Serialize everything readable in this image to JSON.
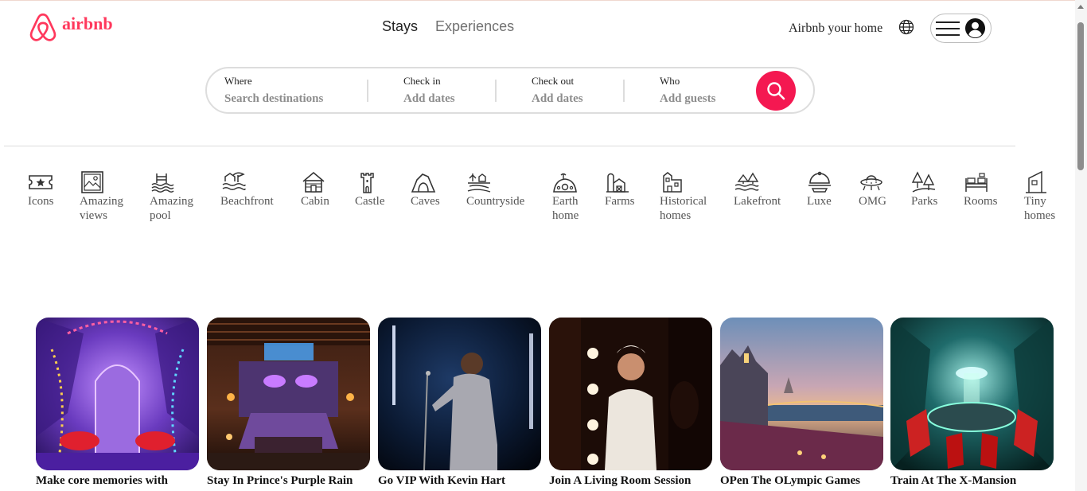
{
  "header": {
    "logo_text": "airbnb",
    "brand_color": "#ff385c",
    "tabs": [
      {
        "label": "Stays",
        "active": true
      },
      {
        "label": "Experiences",
        "active": false
      }
    ],
    "host_link": "Airbnb your home",
    "globe_icon": "globe-icon",
    "menu_icon": "hamburger-menu-icon",
    "avatar_icon": "user-avatar-icon"
  },
  "search": {
    "where": {
      "label": "Where",
      "placeholder": "Search destinations"
    },
    "check_in": {
      "label": "Check in",
      "placeholder": "Add dates"
    },
    "check_out": {
      "label": "Check out",
      "placeholder": "Add dates"
    },
    "who": {
      "label": "Who",
      "placeholder": "Add guests"
    },
    "button_color": "#f41851",
    "button_icon": "search-icon"
  },
  "categories": [
    {
      "label": "Icons",
      "icon": "ticket-star-icon"
    },
    {
      "label": "Amazing\nviews",
      "icon": "framed-picture-icon"
    },
    {
      "label": "Amazing\npool",
      "icon": "pool-icon"
    },
    {
      "label": "Beachfront",
      "icon": "beach-umbrella-icon"
    },
    {
      "label": "Cabin",
      "icon": "cabin-icon"
    },
    {
      "label": "Castle",
      "icon": "castle-icon"
    },
    {
      "label": "Caves",
      "icon": "cave-icon"
    },
    {
      "label": "Countryside",
      "icon": "countryside-icon"
    },
    {
      "label": "Earth\nhome",
      "icon": "earth-home-icon"
    },
    {
      "label": "Farms",
      "icon": "farm-icon"
    },
    {
      "label": "Historical\nhomes",
      "icon": "historical-home-icon"
    },
    {
      "label": "Lakefront",
      "icon": "lakefront-icon"
    },
    {
      "label": "Luxe",
      "icon": "cloche-icon"
    },
    {
      "label": "OMG",
      "icon": "ufo-icon"
    },
    {
      "label": "Parks",
      "icon": "park-trees-icon"
    },
    {
      "label": "Rooms",
      "icon": "bed-room-icon"
    },
    {
      "label": "Tiny\nhomes",
      "icon": "tiny-home-icon"
    }
  ],
  "listings": [
    {
      "title": "Make core memories with",
      "image": "purple-fantasy-room-image"
    },
    {
      "title": "Stay In Prince's Purple Rain",
      "image": "purple-rain-bedroom-image"
    },
    {
      "title": "Go VIP With Kevin Hart",
      "image": "comedian-stage-image"
    },
    {
      "title": "Join A Living Room Session",
      "image": "singer-backstage-mirror-image"
    },
    {
      "title": "OPen The OLympic Games",
      "image": "paris-rooftop-terrace-image"
    },
    {
      "title": "Train At The X-Mansion",
      "image": "x-mansion-cerebro-image"
    }
  ]
}
